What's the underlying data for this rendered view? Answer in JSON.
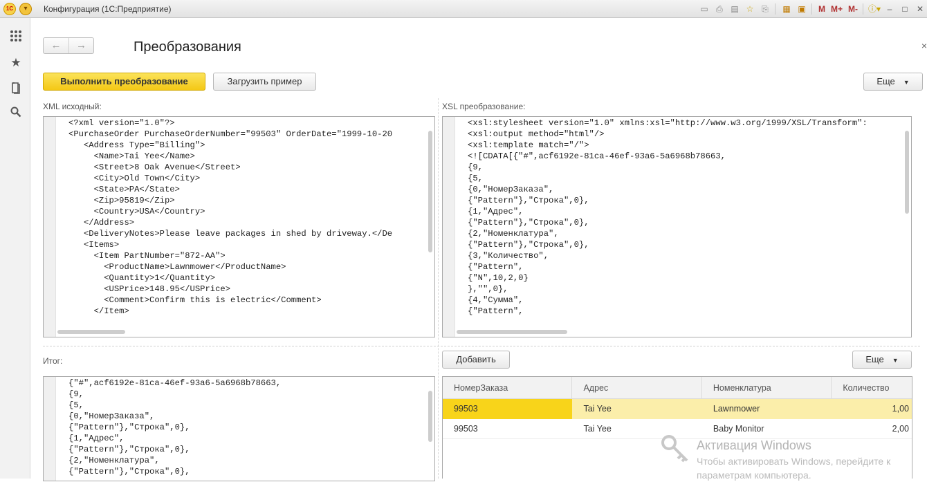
{
  "window": {
    "title": "Конфигурация  (1С:Предприятие)",
    "logo": "1С"
  },
  "titlebar_icons": [
    "save-icon",
    "print-icon",
    "preview-icon",
    "add-favorite-icon",
    "history-icon",
    "calculator-icon",
    "calendar-icon"
  ],
  "titlebar_text_buttons": [
    "M",
    "M+",
    "M-"
  ],
  "sidebar": [
    "apps-grid-icon",
    "star-icon",
    "history-icon",
    "search-icon"
  ],
  "page": {
    "title": "Преобразования",
    "back": "←",
    "forward": "→",
    "close": "×"
  },
  "toolbar": {
    "run_label": "Выполнить преобразование",
    "load_sample_label": "Загрузить пример",
    "more_label": "Еще"
  },
  "xml_source": {
    "label": "XML исходный:",
    "lines": [
      "<?xml version=\"1.0\"?>",
      "<PurchaseOrder PurchaseOrderNumber=\"99503\" OrderDate=\"1999-10-20",
      "   <Address Type=\"Billing\">",
      "     <Name>Tai Yee</Name>",
      "     <Street>8 Oak Avenue</Street>",
      "     <City>Old Town</City>",
      "     <State>PA</State>",
      "     <Zip>95819</Zip>",
      "     <Country>USA</Country>",
      "   </Address>",
      "   <DeliveryNotes>Please leave packages in shed by driveway.</De",
      "   <Items>",
      "     <Item PartNumber=\"872-AA\">",
      "       <ProductName>Lawnmower</ProductName>",
      "       <Quantity>1</Quantity>",
      "       <USPrice>148.95</USPrice>",
      "       <Comment>Confirm this is electric</Comment>",
      "     </Item>"
    ]
  },
  "xsl": {
    "label": "XSL преобразование:",
    "lines": [
      "<xsl:stylesheet version=\"1.0\" xmlns:xsl=\"http://www.w3.org/1999/XSL/Transform\":",
      "<xsl:output method=\"html\"/>",
      "<xsl:template match=\"/\">",
      "<![CDATA[{\"#\",acf6192e-81ca-46ef-93a6-5a6968b78663,",
      "{9,",
      "{5,",
      "{0,\"НомерЗаказа\",",
      "{\"Pattern\"},\"Строка\",0},",
      "{1,\"Адрес\",",
      "{\"Pattern\"},\"Строка\",0},",
      "{2,\"Номенклатура\",",
      "{\"Pattern\"},\"Строка\",0},",
      "{3,\"Количество\",",
      "{\"Pattern\",",
      "{\"N\",10,2,0}",
      "},\"\",0},",
      "{4,\"Сумма\",",
      "{\"Pattern\","
    ]
  },
  "result": {
    "label": "Итог:",
    "lines": [
      "{\"#\",acf6192e-81ca-46ef-93a6-5a6968b78663,",
      "{9,",
      "{5,",
      "{0,\"НомерЗаказа\",",
      "{\"Pattern\"},\"Строка\",0},",
      "{1,\"Адрес\",",
      "{\"Pattern\"},\"Строка\",0},",
      "{2,\"Номенклатура\",",
      "{\"Pattern\"},\"Строка\",0},"
    ]
  },
  "table_toolbar": {
    "add_label": "Добавить",
    "more_label": "Еще"
  },
  "table": {
    "columns": [
      "НомерЗаказа",
      "Адрес",
      "Номенклатура",
      "Количество"
    ],
    "rows": [
      [
        "99503",
        "Tai Yee",
        "Lawnmower",
        "1,00"
      ],
      [
        "99503",
        "Tai Yee",
        "Baby Monitor",
        "2,00"
      ]
    ]
  },
  "watermark": {
    "title": "Активация Windows",
    "line1": "Чтобы активировать Windows, перейдите к",
    "line2": "параметрам компьютера."
  },
  "colors": {
    "accent": "#f4c815",
    "selected_row": "#fbeeaa",
    "current_cell": "#f8d41a"
  }
}
